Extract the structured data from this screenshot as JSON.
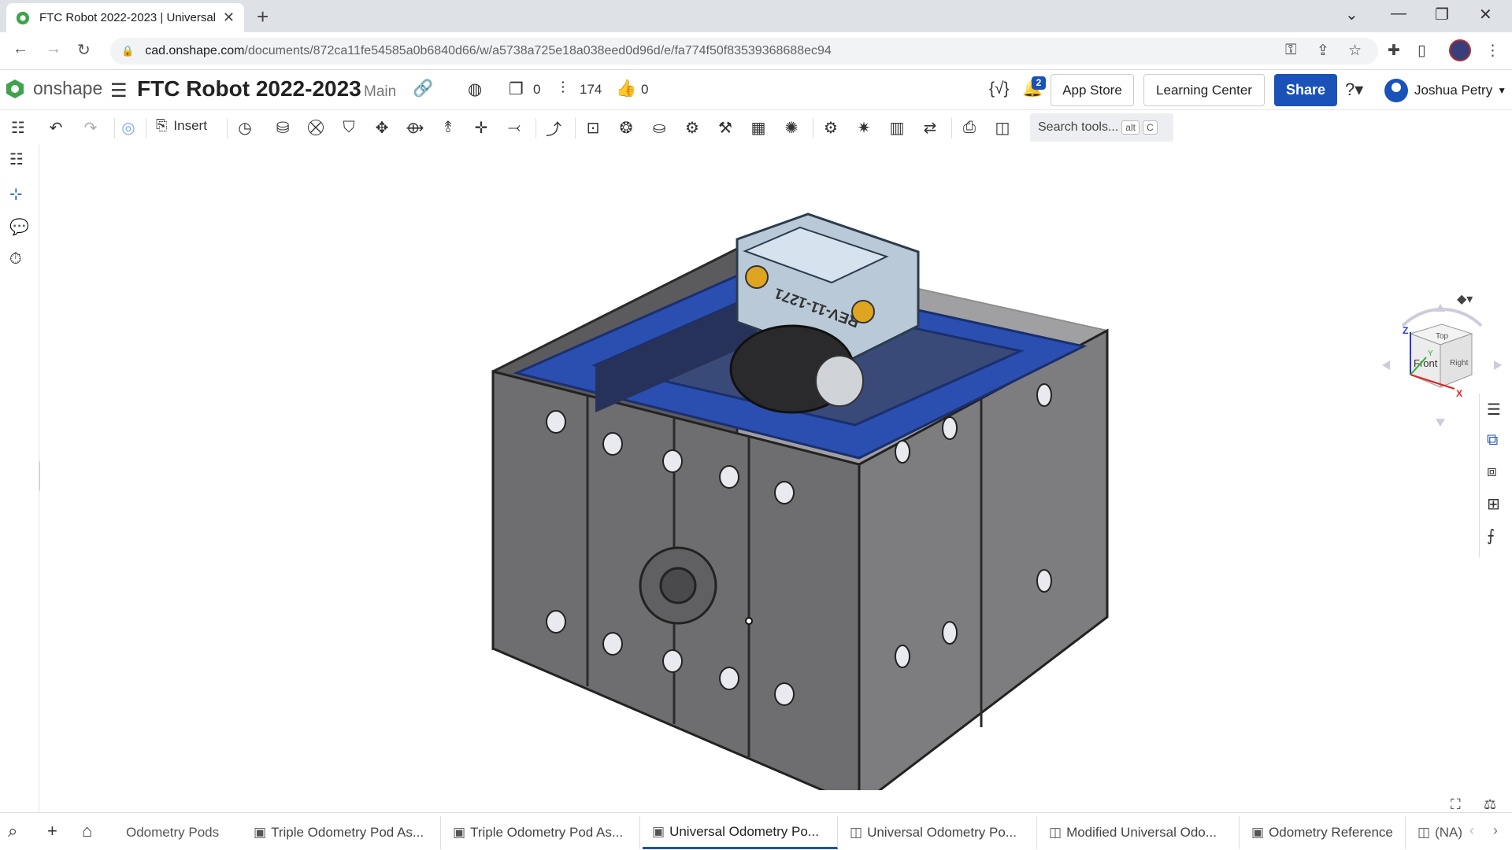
{
  "browser": {
    "tab_title": "FTC Robot 2022-2023 | Universal",
    "url_host": "cad.onshape.com",
    "url_path": "/documents/872ca11fe54585a0b6840d66/w/a5738a725e18a038eed0d96d/e/fa774f50f83539368688ec94"
  },
  "header": {
    "logo": "onshape",
    "doc_title": "FTC Robot 2022-2023",
    "branch": "Main",
    "copies_count": "0",
    "versions_count": "174",
    "likes_count": "0",
    "notifications": "2",
    "app_store": "App Store",
    "learning_center": "Learning Center",
    "share": "Share",
    "user_name": "Joshua Petry"
  },
  "toolbar": {
    "insert_label": "Insert",
    "search_placeholder": "Search tools...",
    "search_key1": "alt",
    "search_key2": "C"
  },
  "viewcube": {
    "top": "Top",
    "front": "Front",
    "right": "Right",
    "axis_z": "Z",
    "axis_x": "X",
    "axis_y": "Y"
  },
  "model": {
    "part_label": "REV-11-1271"
  },
  "bottom_tabs": [
    {
      "label": "Odometry Pods",
      "icon": "folder"
    },
    {
      "label": "Triple Odometry Pod As...",
      "icon": "part-studio-icon"
    },
    {
      "label": "Triple Odometry Pod As...",
      "icon": "part-studio-icon"
    },
    {
      "label": "Universal Odometry Po...",
      "icon": "part-studio-icon"
    },
    {
      "label": "Universal Odometry Po...",
      "icon": "assembly-icon"
    },
    {
      "label": "Modified Universal Odo...",
      "icon": "assembly-icon"
    },
    {
      "label": "Odometry Reference",
      "icon": "part-studio-icon"
    },
    {
      "label": "(NA)",
      "icon": "assembly-icon"
    }
  ],
  "colors": {
    "accent": "#1a52b8",
    "model_blue": "#2b4fb0",
    "housing": "#6e6e70"
  }
}
